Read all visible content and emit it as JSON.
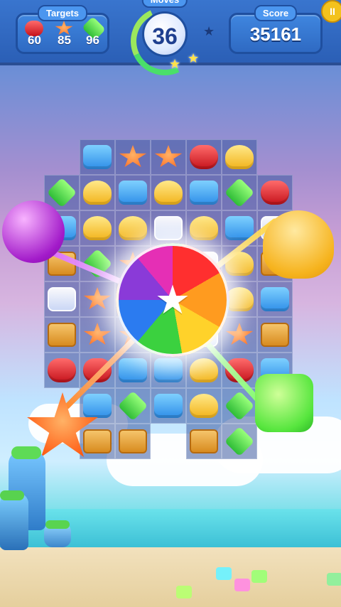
{
  "hud": {
    "targets_label": "Targets",
    "moves_label": "Moves",
    "score_label": "Score",
    "moves_value": "36",
    "score_value": "35161",
    "pause_label": "II",
    "targets": [
      {
        "type": "red-candy",
        "count": "60"
      },
      {
        "type": "orange-star-candy",
        "count": "85"
      },
      {
        "type": "green-candy",
        "count": "96"
      }
    ]
  },
  "board": {
    "cols": 7,
    "rows": 9,
    "cell_types": [
      [
        "empty",
        "blue",
        "orange",
        "orange",
        "red",
        "yellow",
        "empty"
      ],
      [
        "green",
        "yellow",
        "blue",
        "yellow",
        "blue",
        "green",
        "red"
      ],
      [
        "blue",
        "yellow",
        "yellow",
        "ice",
        "yellow",
        "blue",
        "ice"
      ],
      [
        "crate",
        "green",
        "orange",
        "ice",
        "ice",
        "yellow",
        "crate"
      ],
      [
        "ice",
        "orange",
        "ice",
        "ice",
        "ice",
        "yellow",
        "blue"
      ],
      [
        "crate",
        "orange",
        "orange",
        "ice",
        "ice",
        "orange",
        "crate"
      ],
      [
        "red",
        "red",
        "blue",
        "blue",
        "yellow",
        "red",
        "blue"
      ],
      [
        "empty",
        "blue",
        "green",
        "blue",
        "yellow",
        "green",
        "empty"
      ],
      [
        "empty",
        "crate",
        "crate",
        "empty",
        "crate",
        "green",
        "empty"
      ]
    ]
  },
  "effects": {
    "rainbow_ball": {
      "label": "rainbow-ball"
    },
    "big_candies": [
      "purple",
      "yellow",
      "orange-star",
      "green-square"
    ]
  },
  "colors": {
    "panel_blue": "#2f6ac3",
    "accent_yellow": "#f3c21d",
    "text_white": "#ffffff"
  }
}
